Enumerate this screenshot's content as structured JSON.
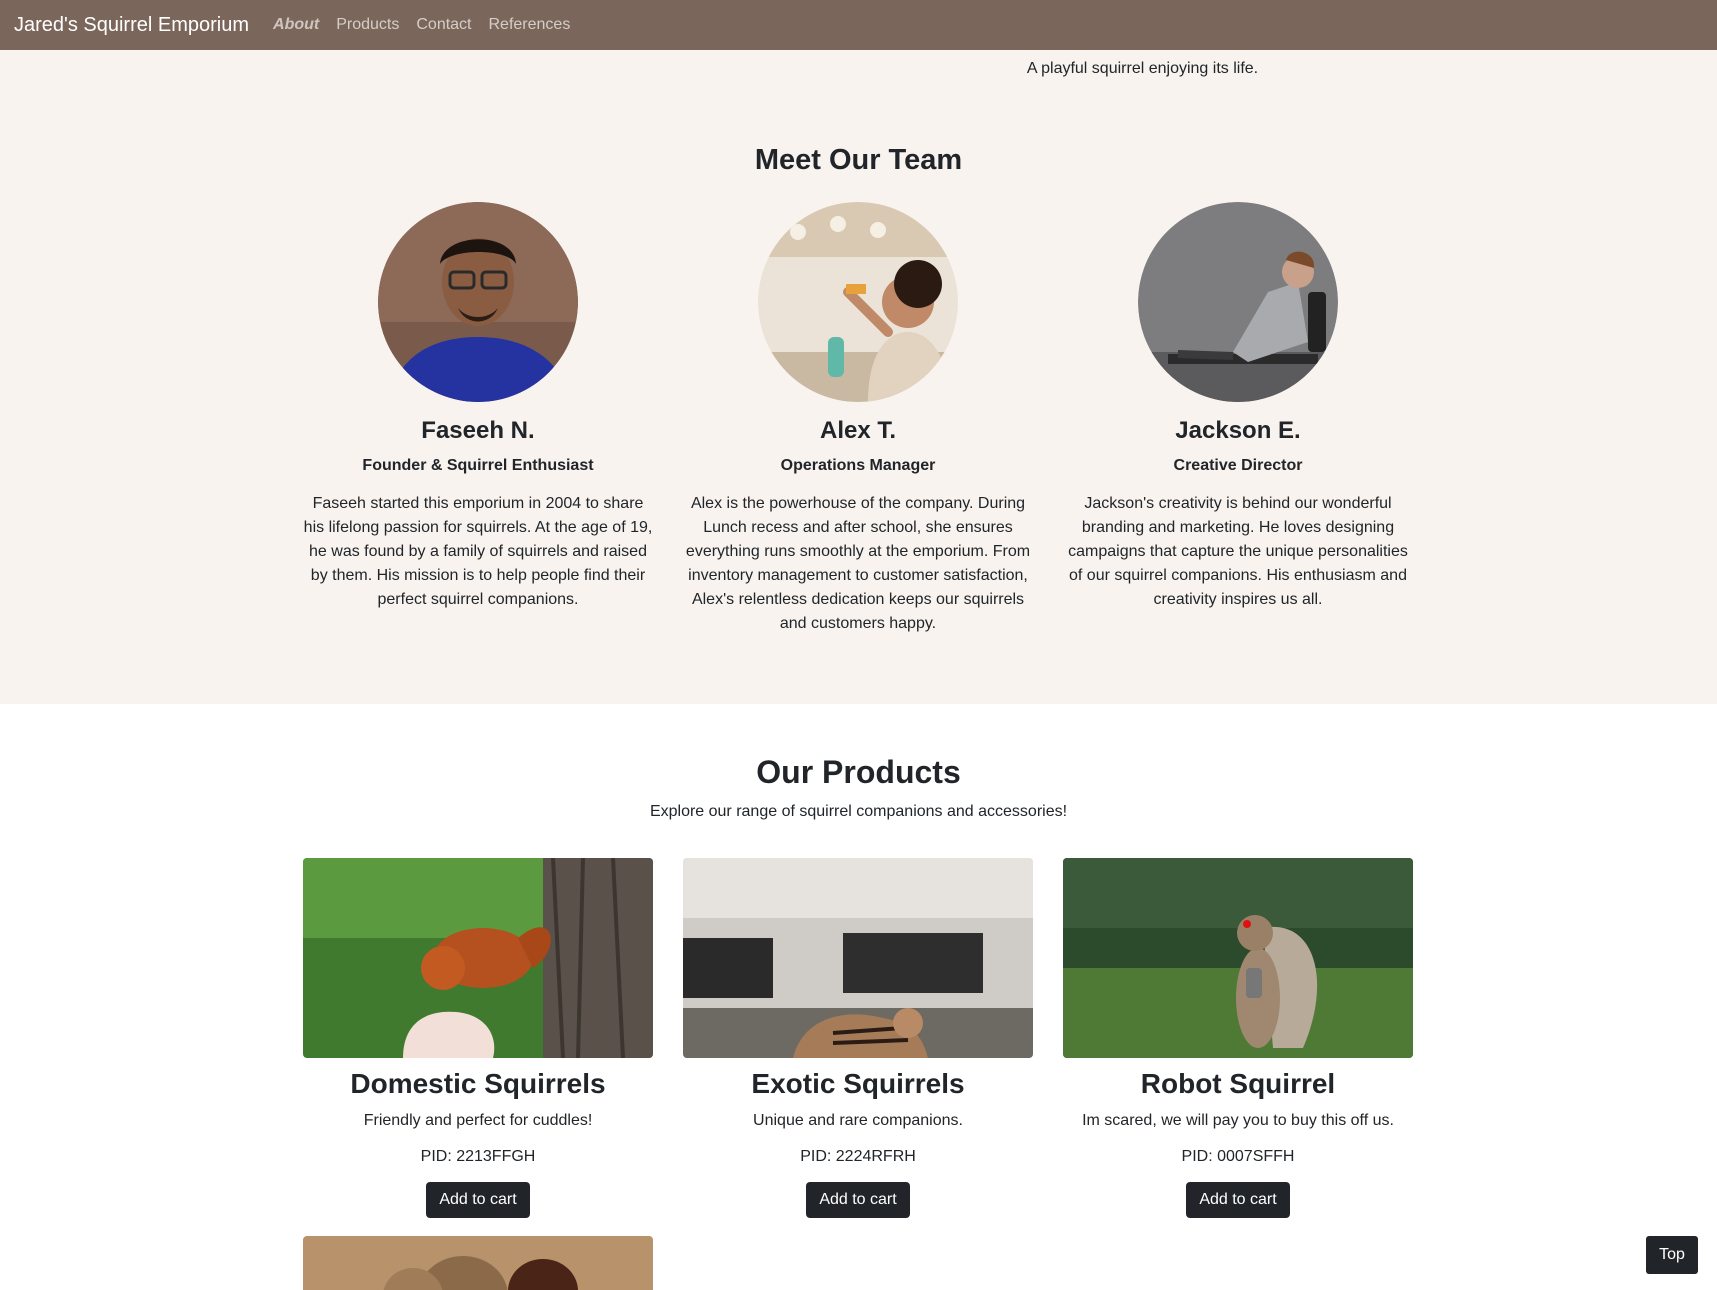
{
  "nav": {
    "brand": "Jared's Squirrel Emporium",
    "links": [
      "About",
      "Products",
      "Contact",
      "References"
    ],
    "active": "About"
  },
  "about": {
    "hero_caption": "A playful squirrel enjoying its life.",
    "team_title": "Meet Our Team",
    "team": [
      {
        "name": "Faseeh N.",
        "role": "Founder & Squirrel Enthusiast",
        "bio": "Faseeh started this emporium in 2004 to share his lifelong passion for squirrels. At the age of 19, he was found by a family of squirrels and raised by them. His mission is to help people find their perfect squirrel companions."
      },
      {
        "name": "Alex T.",
        "role": "Operations Manager",
        "bio": "Alex is the powerhouse of the company. During Lunch recess and after school, she ensures everything runs smoothly at the emporium. From inventory management to customer satisfaction, Alex's relentless dedication keeps our squirrels and customers happy."
      },
      {
        "name": "Jackson E.",
        "role": "Creative Director",
        "bio": "Jackson's creativity is behind our wonderful branding and marketing. He loves designing campaigns that capture the unique personalities of our squirrel companions. His enthusiasm and creativity inspires us all."
      }
    ]
  },
  "products": {
    "title": "Our Products",
    "subtitle": "Explore our range of squirrel companions and accessories!",
    "items": [
      {
        "name": "Domestic Squirrels",
        "desc": "Friendly and perfect for cuddles!",
        "pid": "PID: 2213FFGH",
        "button": "Add to cart"
      },
      {
        "name": "Exotic Squirrels",
        "desc": "Unique and rare companions.",
        "pid": "PID: 2224RFRH",
        "button": "Add to cart"
      },
      {
        "name": "Robot Squirrel",
        "desc": "Im scared, we will pay you to buy this off us.",
        "pid": "PID: 0007SFFH",
        "button": "Add to cart"
      }
    ]
  },
  "top_button": "Top",
  "colors": {
    "navbar": "#7b665b",
    "about_bg": "#f8f3ef",
    "button": "#212529"
  }
}
